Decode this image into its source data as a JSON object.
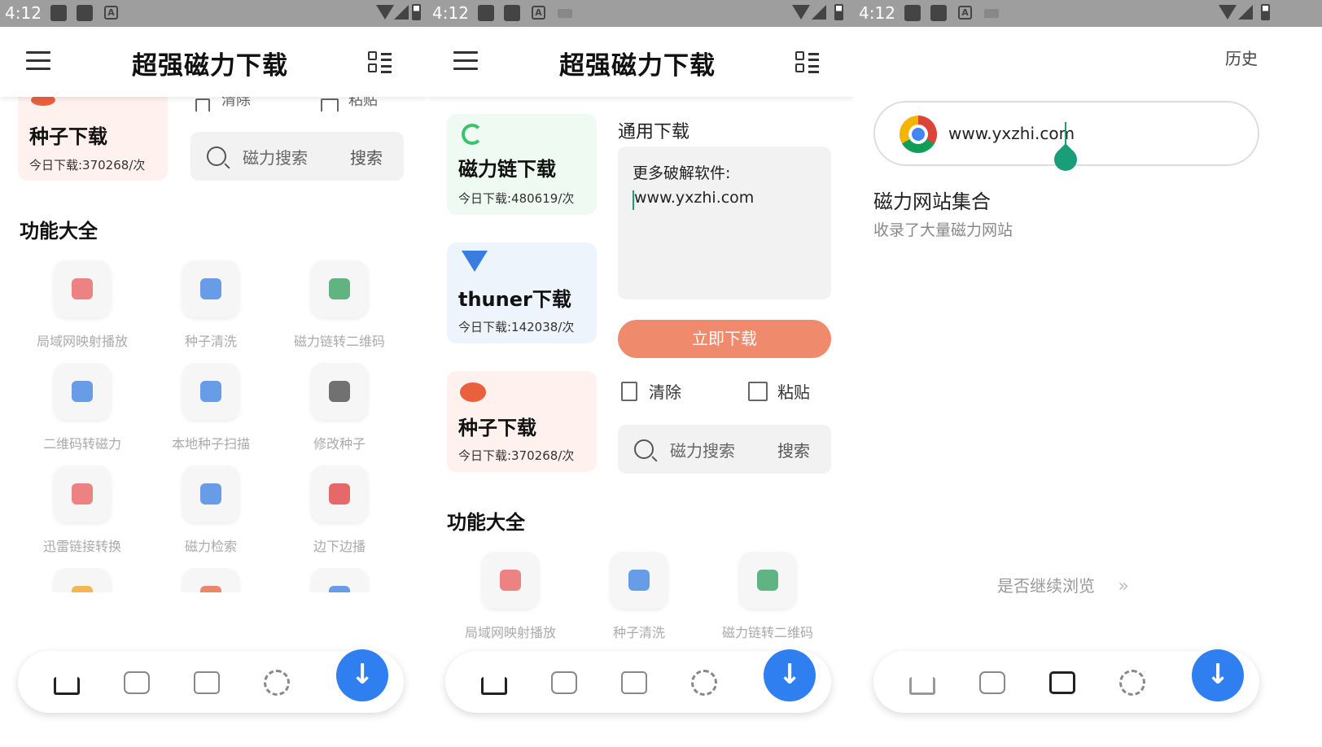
{
  "status_bars": [
    {
      "time": "4:12"
    },
    {
      "time": "4:12"
    },
    {
      "time": "4:12"
    }
  ],
  "app": {
    "title": "超强磁力下载"
  },
  "panel1": {
    "clear_label": "清除",
    "paste_label": "粘贴",
    "seed_card": {
      "name": "种子下载",
      "stat": "今日下载:370268/次"
    },
    "search": {
      "placeholder": "磁力搜索",
      "button": "搜索"
    },
    "section_title": "功能大全",
    "features": [
      {
        "label": "局域网映射播放",
        "icon": "video-cast-icon"
      },
      {
        "label": "种子清洗",
        "icon": "gears-icon"
      },
      {
        "label": "磁力链转二维码",
        "icon": "qr-code-icon"
      },
      {
        "label": "二维码转磁力",
        "icon": "qr-scan-icon"
      },
      {
        "label": "本地种子扫描",
        "icon": "magnifier-icon"
      },
      {
        "label": "修改种子",
        "icon": "edit-icon"
      },
      {
        "label": "迅雷链接转换",
        "icon": "link-icon"
      },
      {
        "label": "磁力检索",
        "icon": "search-job-icon"
      },
      {
        "label": "边下边播",
        "icon": "play-icon"
      },
      {
        "label": "",
        "icon": "folder-icon"
      },
      {
        "label": "",
        "icon": "fire-icon"
      },
      {
        "label": "",
        "icon": "cloud-download-icon"
      }
    ]
  },
  "panel2": {
    "cards": [
      {
        "name": "磁力链下载",
        "stat": "今日下载:480619/次",
        "icon": "magnet-refresh-icon"
      },
      {
        "name": "thuner下载",
        "stat": "今日下载:142038/次",
        "icon": "bird-icon"
      },
      {
        "name": "种子下载",
        "stat": "今日下载:370268/次",
        "icon": "seed-icon"
      }
    ],
    "general_download_label": "通用下载",
    "textarea_line1": "更多破解软件:",
    "textarea_line2": "www.yxzhi.com",
    "download_now_button": "立即下载",
    "clear_label": "清除",
    "paste_label": "粘贴",
    "search": {
      "placeholder": "磁力搜索",
      "button": "搜索"
    },
    "section_title": "功能大全",
    "features": [
      {
        "label": "局域网映射播放",
        "icon": "video-cast-icon"
      },
      {
        "label": "种子清洗",
        "icon": "gears-icon"
      },
      {
        "label": "磁力链转二维码",
        "icon": "qr-code-icon"
      }
    ]
  },
  "panel3": {
    "history_label": "历史",
    "url_value": "www.yxzhi.com",
    "collection_title": "磁力网站集合",
    "collection_subtitle": "收录了大量磁力网站",
    "continue_label": "是否继续浏览"
  },
  "nav": {
    "items": [
      "home-icon",
      "tv-icon",
      "cards-icon",
      "settings-icon"
    ],
    "download_icon": "download-icon",
    "download_glyph": "↓"
  },
  "colors": {
    "accent_blue": "#2f7ff0",
    "orange_button": "#ef8a6c",
    "green_highlight": "#5fd33a",
    "cursor_green": "#1a9e7a"
  }
}
